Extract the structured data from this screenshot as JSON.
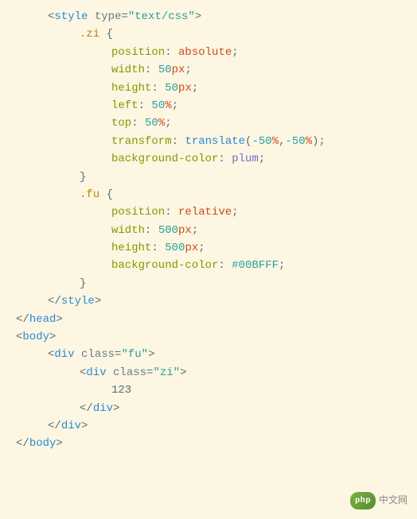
{
  "code": {
    "lines": [
      {
        "indent": 1,
        "tokens": [
          {
            "t": "tag-bracket",
            "v": "<"
          },
          {
            "t": "tag-name",
            "v": "style"
          },
          {
            "t": "text-content",
            "v": " "
          },
          {
            "t": "attr-name",
            "v": "type"
          },
          {
            "t": "tag-bracket",
            "v": "="
          },
          {
            "t": "attr-value",
            "v": "\"text/css\""
          },
          {
            "t": "tag-bracket",
            "v": ">"
          }
        ]
      },
      {
        "indent": 2,
        "tokens": [
          {
            "t": "selector",
            "v": ".zi"
          },
          {
            "t": "text-content",
            "v": " "
          },
          {
            "t": "brace",
            "v": "{"
          }
        ]
      },
      {
        "indent": 3,
        "tokens": [
          {
            "t": "property",
            "v": "position"
          },
          {
            "t": "colon",
            "v": ": "
          },
          {
            "t": "value-keyword",
            "v": "absolute"
          },
          {
            "t": "semicolon",
            "v": ";"
          }
        ]
      },
      {
        "indent": 3,
        "tokens": [
          {
            "t": "property",
            "v": "width"
          },
          {
            "t": "colon",
            "v": ": "
          },
          {
            "t": "value-number",
            "v": "50"
          },
          {
            "t": "value-unit",
            "v": "px"
          },
          {
            "t": "semicolon",
            "v": ";"
          }
        ]
      },
      {
        "indent": 3,
        "tokens": [
          {
            "t": "property",
            "v": "height"
          },
          {
            "t": "colon",
            "v": ": "
          },
          {
            "t": "value-number",
            "v": "50"
          },
          {
            "t": "value-unit",
            "v": "px"
          },
          {
            "t": "semicolon",
            "v": ";"
          }
        ]
      },
      {
        "indent": 3,
        "tokens": [
          {
            "t": "property",
            "v": "left"
          },
          {
            "t": "colon",
            "v": ": "
          },
          {
            "t": "value-number",
            "v": "50"
          },
          {
            "t": "value-percent",
            "v": "%"
          },
          {
            "t": "semicolon",
            "v": ";"
          }
        ]
      },
      {
        "indent": 3,
        "tokens": [
          {
            "t": "property",
            "v": "top"
          },
          {
            "t": "colon",
            "v": ": "
          },
          {
            "t": "value-number",
            "v": "50"
          },
          {
            "t": "value-percent",
            "v": "%"
          },
          {
            "t": "semicolon",
            "v": ";"
          }
        ]
      },
      {
        "indent": 3,
        "tokens": [
          {
            "t": "property",
            "v": "transform"
          },
          {
            "t": "colon",
            "v": ": "
          },
          {
            "t": "value-func",
            "v": "translate"
          },
          {
            "t": "paren",
            "v": "("
          },
          {
            "t": "value-number",
            "v": "-50"
          },
          {
            "t": "value-percent",
            "v": "%"
          },
          {
            "t": "comma",
            "v": ","
          },
          {
            "t": "value-number",
            "v": "-50"
          },
          {
            "t": "value-percent",
            "v": "%"
          },
          {
            "t": "paren",
            "v": ")"
          },
          {
            "t": "semicolon",
            "v": ";"
          }
        ]
      },
      {
        "indent": 3,
        "tokens": [
          {
            "t": "property",
            "v": "background-color"
          },
          {
            "t": "colon",
            "v": ": "
          },
          {
            "t": "value-color",
            "v": "plum"
          },
          {
            "t": "semicolon",
            "v": ";"
          }
        ]
      },
      {
        "indent": 2,
        "tokens": [
          {
            "t": "brace",
            "v": "}"
          }
        ]
      },
      {
        "indent": 2,
        "tokens": [
          {
            "t": "selector",
            "v": ".fu"
          },
          {
            "t": "text-content",
            "v": " "
          },
          {
            "t": "brace",
            "v": "{"
          }
        ]
      },
      {
        "indent": 3,
        "tokens": [
          {
            "t": "property",
            "v": "position"
          },
          {
            "t": "colon",
            "v": ": "
          },
          {
            "t": "value-keyword",
            "v": "relative"
          },
          {
            "t": "semicolon",
            "v": ";"
          }
        ]
      },
      {
        "indent": 3,
        "tokens": [
          {
            "t": "property",
            "v": "width"
          },
          {
            "t": "colon",
            "v": ": "
          },
          {
            "t": "value-number",
            "v": "500"
          },
          {
            "t": "value-unit",
            "v": "px"
          },
          {
            "t": "semicolon",
            "v": ";"
          }
        ]
      },
      {
        "indent": 3,
        "tokens": [
          {
            "t": "property",
            "v": "height"
          },
          {
            "t": "colon",
            "v": ": "
          },
          {
            "t": "value-number",
            "v": "500"
          },
          {
            "t": "value-unit",
            "v": "px"
          },
          {
            "t": "semicolon",
            "v": ";"
          }
        ]
      },
      {
        "indent": 3,
        "tokens": [
          {
            "t": "property",
            "v": "background-color"
          },
          {
            "t": "colon",
            "v": ": "
          },
          {
            "t": "value-hex",
            "v": "#00BFFF"
          },
          {
            "t": "semicolon",
            "v": ";"
          }
        ]
      },
      {
        "indent": 2,
        "tokens": [
          {
            "t": "brace",
            "v": "}"
          }
        ]
      },
      {
        "indent": 1,
        "tokens": [
          {
            "t": "tag-bracket",
            "v": "</"
          },
          {
            "t": "tag-name",
            "v": "style"
          },
          {
            "t": "tag-bracket",
            "v": ">"
          }
        ]
      },
      {
        "indent": 0,
        "tokens": [
          {
            "t": "tag-bracket",
            "v": "</"
          },
          {
            "t": "tag-name",
            "v": "head"
          },
          {
            "t": "tag-bracket",
            "v": ">"
          }
        ]
      },
      {
        "indent": 0,
        "tokens": [
          {
            "t": "tag-bracket",
            "v": "<"
          },
          {
            "t": "tag-name",
            "v": "body"
          },
          {
            "t": "tag-bracket",
            "v": ">"
          }
        ]
      },
      {
        "indent": 1,
        "tokens": [
          {
            "t": "tag-bracket",
            "v": "<"
          },
          {
            "t": "tag-name",
            "v": "div"
          },
          {
            "t": "text-content",
            "v": " "
          },
          {
            "t": "attr-name",
            "v": "class"
          },
          {
            "t": "tag-bracket",
            "v": "="
          },
          {
            "t": "attr-value",
            "v": "\"fu\""
          },
          {
            "t": "tag-bracket",
            "v": ">"
          }
        ]
      },
      {
        "indent": 2,
        "tokens": [
          {
            "t": "tag-bracket",
            "v": "<"
          },
          {
            "t": "tag-name",
            "v": "div"
          },
          {
            "t": "text-content",
            "v": " "
          },
          {
            "t": "attr-name",
            "v": "class"
          },
          {
            "t": "tag-bracket",
            "v": "="
          },
          {
            "t": "attr-value",
            "v": "\"zi\""
          },
          {
            "t": "tag-bracket",
            "v": ">"
          }
        ]
      },
      {
        "indent": 3,
        "tokens": [
          {
            "t": "text-content",
            "v": "123"
          }
        ]
      },
      {
        "indent": 2,
        "tokens": [
          {
            "t": "tag-bracket",
            "v": "</"
          },
          {
            "t": "tag-name",
            "v": "div"
          },
          {
            "t": "tag-bracket",
            "v": ">"
          }
        ]
      },
      {
        "indent": 1,
        "tokens": [
          {
            "t": "tag-bracket",
            "v": "</"
          },
          {
            "t": "tag-name",
            "v": "div"
          },
          {
            "t": "tag-bracket",
            "v": ">"
          }
        ]
      },
      {
        "indent": 0,
        "tokens": [
          {
            "t": "tag-bracket",
            "v": "</"
          },
          {
            "t": "tag-name",
            "v": "body"
          },
          {
            "t": "tag-bracket",
            "v": ">"
          }
        ]
      }
    ]
  },
  "watermark": {
    "badge": "php",
    "text": "中文网"
  }
}
